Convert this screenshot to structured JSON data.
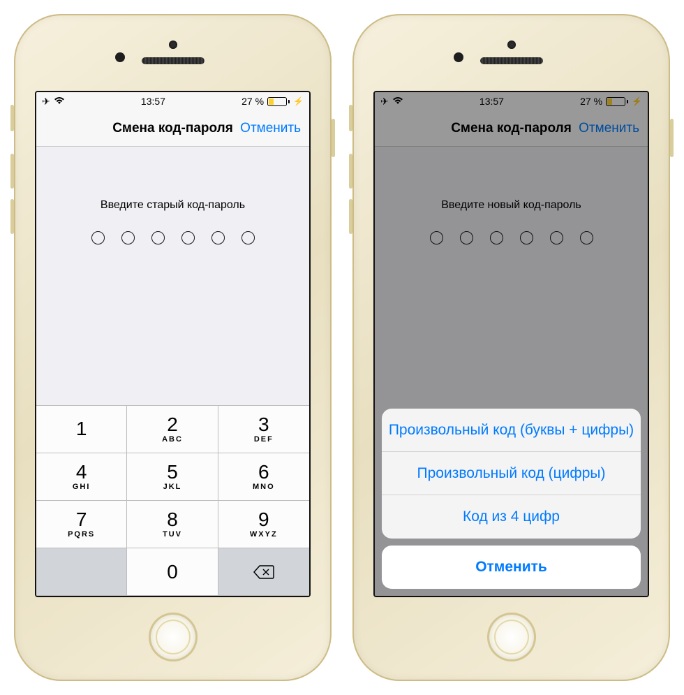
{
  "status": {
    "time": "13:57",
    "battery_text": "27 %",
    "battery_level": 27,
    "airplane": true,
    "wifi": true,
    "charging": true
  },
  "nav": {
    "title": "Смена код-пароля",
    "cancel": "Отменить"
  },
  "left_screen": {
    "prompt": "Введите старый код-пароль",
    "passcode_length": 6,
    "keypad": [
      {
        "num": "1",
        "letters": ""
      },
      {
        "num": "2",
        "letters": "ABC"
      },
      {
        "num": "3",
        "letters": "DEF"
      },
      {
        "num": "4",
        "letters": "GHI"
      },
      {
        "num": "5",
        "letters": "JKL"
      },
      {
        "num": "6",
        "letters": "MNO"
      },
      {
        "num": "7",
        "letters": "PQRS"
      },
      {
        "num": "8",
        "letters": "TUV"
      },
      {
        "num": "9",
        "letters": "WXYZ"
      },
      {
        "num": "0",
        "letters": ""
      }
    ]
  },
  "right_screen": {
    "prompt": "Введите новый код-пароль",
    "passcode_length": 6,
    "sheet_options": [
      "Произвольный код (буквы + цифры)",
      "Произвольный код (цифры)",
      "Код из 4 цифр"
    ],
    "sheet_cancel": "Отменить"
  }
}
